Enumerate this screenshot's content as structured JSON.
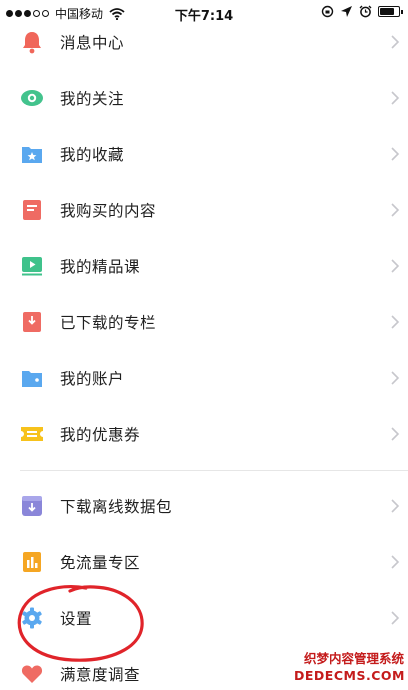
{
  "status_bar": {
    "carrier": "中国移动",
    "time": "下午7:14",
    "signal_dots_filled": 3,
    "signal_dots_total": 5,
    "battery_level": 0.85
  },
  "menu": {
    "items": [
      {
        "label": "消息中心",
        "icon": "bell-icon",
        "color": "#f0665a"
      },
      {
        "label": "我的关注",
        "icon": "eye-icon",
        "color": "#43c38d"
      },
      {
        "label": "我的收藏",
        "icon": "star-folder-icon",
        "color": "#5aa8ef"
      },
      {
        "label": "我购买的内容",
        "icon": "receipt-icon",
        "color": "#ef6b63"
      },
      {
        "label": "我的精品课",
        "icon": "video-icon",
        "color": "#3fc28b"
      },
      {
        "label": "已下载的专栏",
        "icon": "download-bookmark-icon",
        "color": "#ef6b63"
      },
      {
        "label": "我的账户",
        "icon": "wallet-icon",
        "color": "#5aa8ef"
      },
      {
        "label": "我的优惠券",
        "icon": "coupon-icon",
        "color": "#f7c21b"
      },
      {
        "label": "下载离线数据包",
        "icon": "download-box-icon",
        "color": "#8a86d9"
      },
      {
        "label": "免流量专区",
        "icon": "data-chart-icon",
        "color": "#f5a623"
      },
      {
        "label": "设置",
        "icon": "gear-icon",
        "color": "#5aa8ef"
      },
      {
        "label": "满意度调查",
        "icon": "heart-icon",
        "color": "#ef6b63"
      }
    ]
  },
  "annotation_color": "#e0242a",
  "watermark": {
    "line1": "织梦内容管理系统",
    "line2": "DEDECMS.COM"
  }
}
